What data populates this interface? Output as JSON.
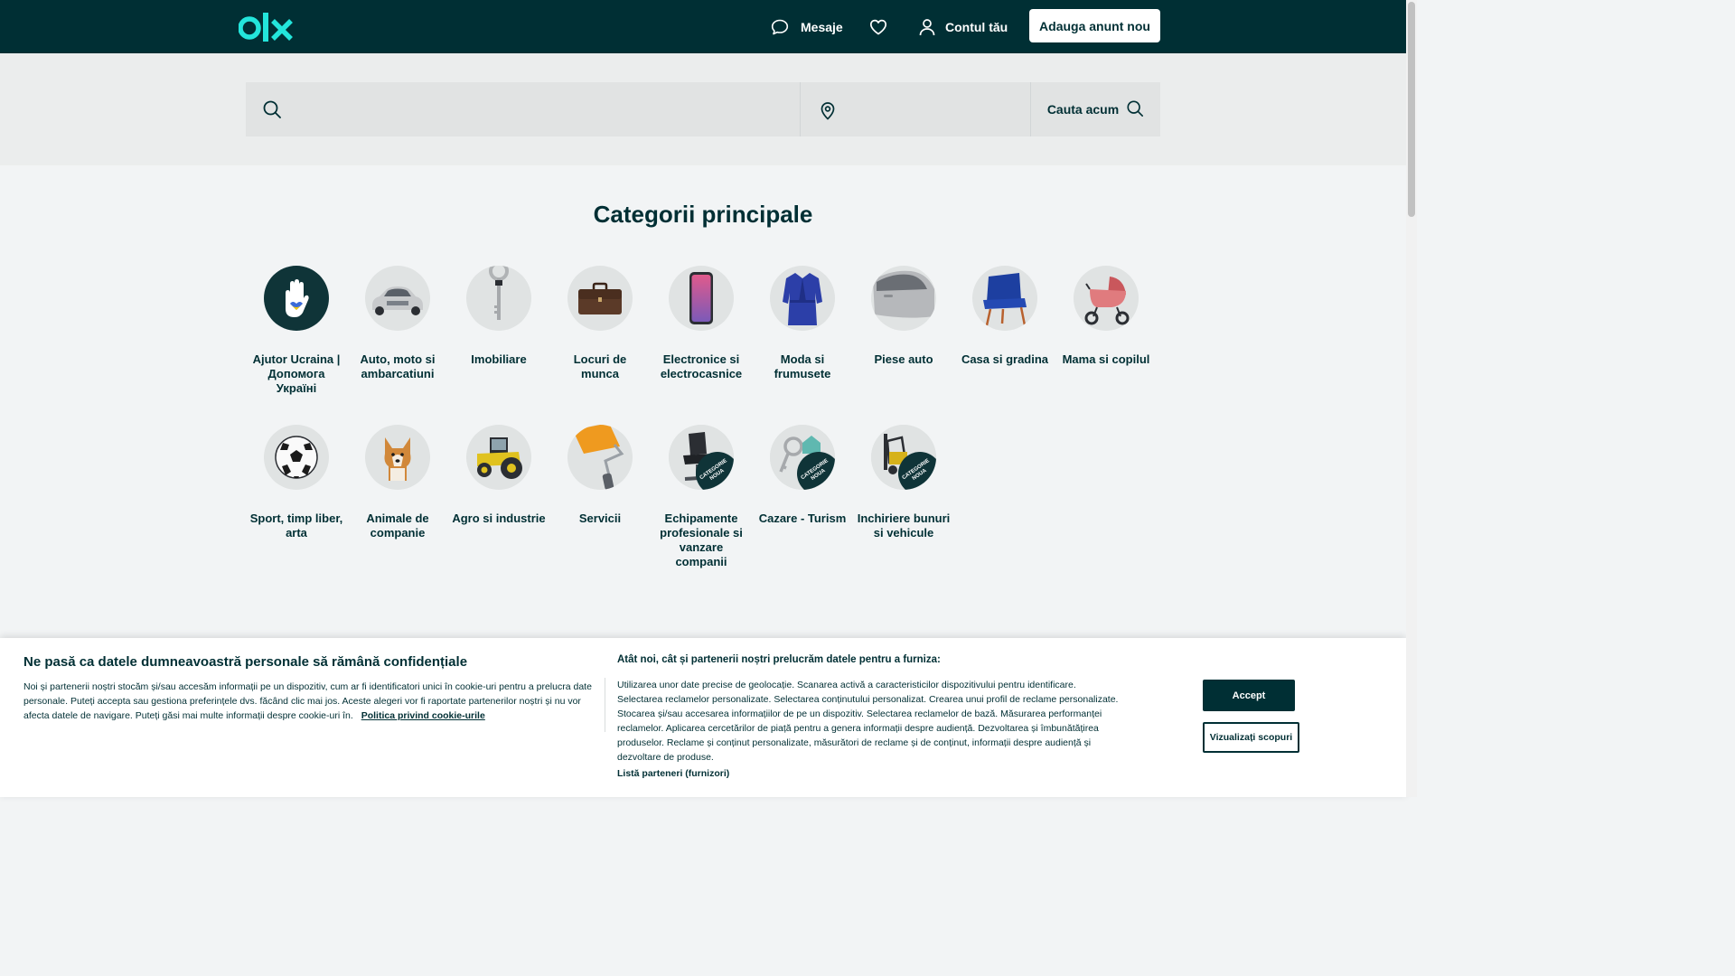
{
  "header": {
    "logo_text": "olx",
    "messages_label": "Mesaje",
    "account_label": "Contul tău",
    "post_button": "Adauga anunt nou"
  },
  "search": {
    "query_value": "",
    "location_value": "",
    "button_label": "Cauta acum"
  },
  "categories": {
    "title": "Categorii principale",
    "items": [
      {
        "label": "Ajutor Ucraina | Допомога Україні",
        "icon": "ukraine-help-icon"
      },
      {
        "label": "Auto, moto si ambarcatiuni",
        "icon": "car-icon"
      },
      {
        "label": "Imobiliare",
        "icon": "key-icon"
      },
      {
        "label": "Locuri de munca",
        "icon": "briefcase-icon"
      },
      {
        "label": "Electronice si electrocasnice",
        "icon": "phone-icon"
      },
      {
        "label": "Moda si frumusete",
        "icon": "robe-icon"
      },
      {
        "label": "Piese auto",
        "icon": "car-door-icon"
      },
      {
        "label": "Casa si gradina",
        "icon": "chair-icon"
      },
      {
        "label": "Mama si copilul",
        "icon": "stroller-icon"
      },
      {
        "label": "Sport, timp liber, arta",
        "icon": "football-icon"
      },
      {
        "label": "Animale de companie",
        "icon": "dog-icon"
      },
      {
        "label": "Agro si industrie",
        "icon": "tractor-icon"
      },
      {
        "label": "Servicii",
        "icon": "paint-roller-icon"
      },
      {
        "label": "Echipamente profesionale si vanzare companii",
        "icon": "salon-chair-icon",
        "badge": "CATEGORIE NOUA"
      },
      {
        "label": "Cazare - Turism",
        "icon": "house-keys-icon",
        "badge": "CATEGORIE NOUA"
      },
      {
        "label": "Inchiriere bunuri si vehicule",
        "icon": "forklift-icon",
        "badge": "CATEGORIE NOUA"
      }
    ]
  },
  "cookie": {
    "title": "Ne pasă ca datele dumneavoastră personale să rămână confidențiale",
    "text": "Noi și partenerii noștri stocăm și/sau accesăm informații pe un dispozitiv, cum ar fi identificatori unici în cookie-uri pentru a prelucra date personale. Puteți accepta sau gestiona preferințele dvs. făcând clic mai jos. Aceste alegeri vor fi raportate partenerilor noștri și nu vor afecta datele de navigare. Puteți găsi mai multe informații despre cookie-uri în.",
    "policy_link": "Politica privind cookie-urile",
    "right_title": "Atât noi, cât și partenerii noștri prelucrăm datele pentru a furniza:",
    "right_text": "Utilizarea unor date precise de geolocație. Scanarea activă a caracteristicilor dispozitivului pentru identificare. Selectarea reclamelor personalizate. Selectarea conținutului personalizat. Crearea unui profil de reclame personalizate. Stocarea și/sau accesarea informațiilor de pe un dispozitiv. Selectarea reclamelor de bază. Măsurarea performanței reclamelor. Aplicarea cercetărilor de piață pentru a genera informații despre audiență. Dezvoltarea și îmbunătățirea produselor. Reclame și conținut personalizate, măsurători de reclame și de conținut, informații despre audiență și dezvoltare de produse.",
    "partners_link": "Listă parteneri (furnizori)",
    "accept_button": "Accept",
    "purposes_button": "Vizualizați scopuri"
  },
  "colors": {
    "brand_dark": "#002f34",
    "brand_teal": "#23e5db",
    "background": "#f2f4f5"
  }
}
